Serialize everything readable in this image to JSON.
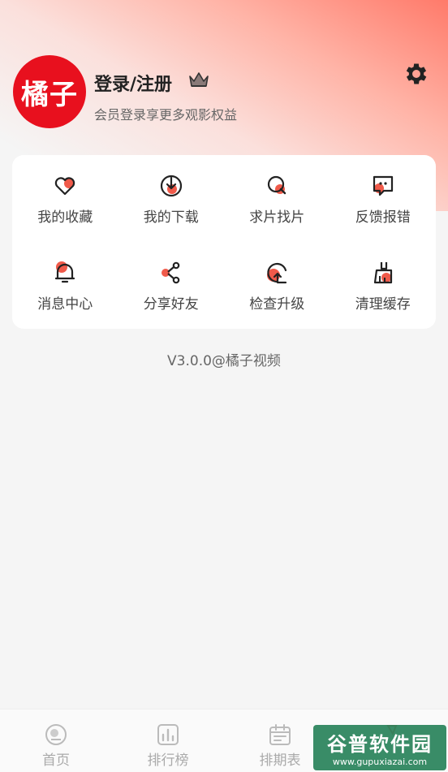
{
  "header": {
    "avatar_text": "橘子",
    "login_title": "登录/注册",
    "login_subtitle": "会员登录享更多观影权益",
    "crown_icon": "crown-icon",
    "settings_icon": "gear-icon"
  },
  "menu": {
    "items": [
      {
        "label": "我的收藏",
        "icon": "heart-icon"
      },
      {
        "label": "我的下载",
        "icon": "download-icon"
      },
      {
        "label": "求片找片",
        "icon": "search-icon"
      },
      {
        "label": "反馈报错",
        "icon": "feedback-icon"
      },
      {
        "label": "消息中心",
        "icon": "bell-icon"
      },
      {
        "label": "分享好友",
        "icon": "share-icon"
      },
      {
        "label": "检查升级",
        "icon": "upgrade-icon"
      },
      {
        "label": "清理缓存",
        "icon": "broom-icon"
      }
    ]
  },
  "version": "V3.0.0@橘子视频",
  "tabbar": {
    "tabs": [
      {
        "label": "首页",
        "icon": "home-icon"
      },
      {
        "label": "排行榜",
        "icon": "ranking-icon"
      },
      {
        "label": "排期表",
        "icon": "calendar-icon"
      },
      {
        "label": "",
        "icon": "profile-icon"
      }
    ]
  },
  "watermark": {
    "line1": "谷普软件园",
    "line2": "www.gupuxiazai.com"
  },
  "colors": {
    "accent": "#f05a4a",
    "brand": "#e8101e"
  }
}
